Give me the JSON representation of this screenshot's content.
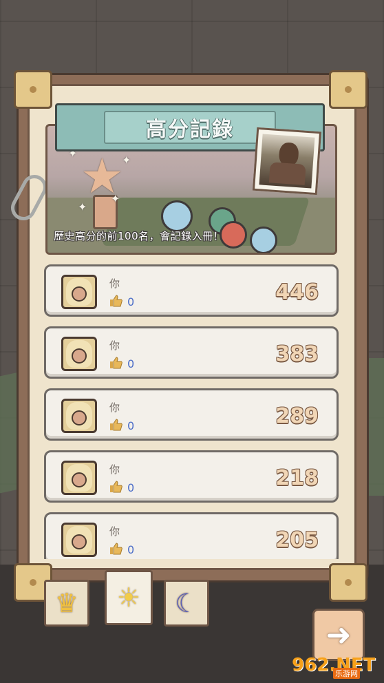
{
  "header": {
    "title": "高分記錄",
    "caption": "歷史高分的前100名，會記錄入冊！"
  },
  "records": [
    {
      "name": "你",
      "likes": "0",
      "score": "446"
    },
    {
      "name": "你",
      "likes": "0",
      "score": "383"
    },
    {
      "name": "你",
      "likes": "0",
      "score": "289"
    },
    {
      "name": "你",
      "likes": "0",
      "score": "218"
    },
    {
      "name": "你",
      "likes": "0",
      "score": "205"
    }
  ],
  "tabs": [
    {
      "icon": "crown-icon",
      "glyph": "♛",
      "selected": false
    },
    {
      "icon": "sun-icon",
      "glyph": "☀",
      "selected": true
    },
    {
      "icon": "moon-icon",
      "glyph": "☾",
      "selected": false
    }
  ],
  "next_button": {
    "icon": "arrow-right-icon",
    "glyph": "➜"
  },
  "watermark": {
    "brand": "962.NET",
    "sub": "乐游网"
  },
  "colors": {
    "panel": "#efe4cd",
    "title_plaque": "#8dbcb6",
    "score_text": "#f1d6b6",
    "likes_text": "#4c6ec8"
  }
}
